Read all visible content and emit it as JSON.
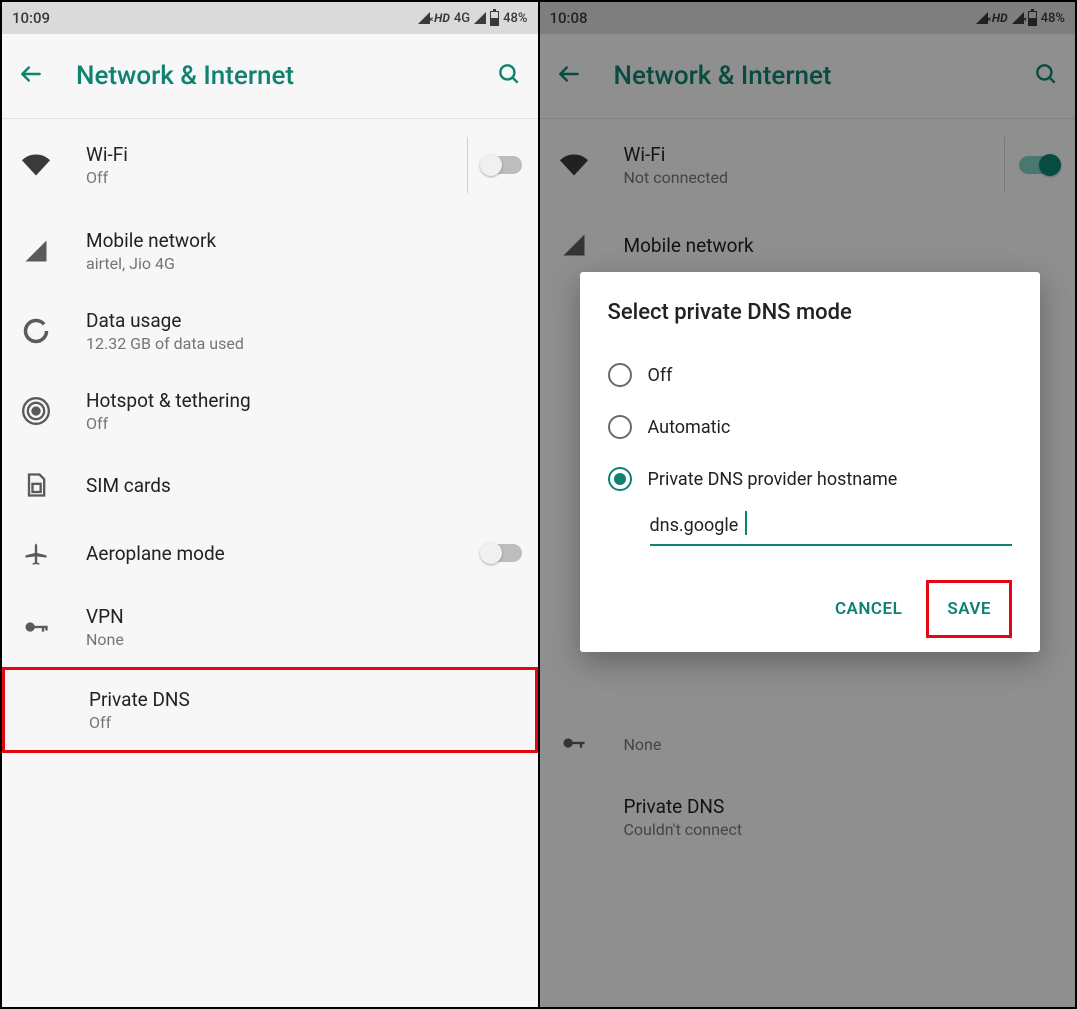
{
  "left": {
    "status": {
      "time": "10:09",
      "hd": "HD",
      "net": "4G",
      "battery": "48%"
    },
    "appbar": {
      "title": "Network & Internet"
    },
    "items": {
      "wifi": {
        "title": "Wi-Fi",
        "sub": "Off"
      },
      "mobile": {
        "title": "Mobile network",
        "sub": "airtel, Jio 4G"
      },
      "data": {
        "title": "Data usage",
        "sub": "12.32 GB of data used"
      },
      "hotspot": {
        "title": "Hotspot & tethering",
        "sub": "Off"
      },
      "sim": {
        "title": "SIM cards"
      },
      "aero": {
        "title": "Aeroplane mode"
      },
      "vpn": {
        "title": "VPN",
        "sub": "None"
      },
      "pdns": {
        "title": "Private DNS",
        "sub": "Off"
      }
    }
  },
  "right": {
    "status": {
      "time": "10:08",
      "hd": "HD",
      "battery": "48%"
    },
    "appbar": {
      "title": "Network & Internet"
    },
    "items": {
      "wifi": {
        "title": "Wi-Fi",
        "sub": "Not connected"
      },
      "mobile": {
        "title": "Mobile network"
      },
      "vpn": {
        "sub": "None"
      },
      "pdns": {
        "title": "Private DNS",
        "sub": "Couldn't connect"
      }
    },
    "dialog": {
      "title": "Select private DNS mode",
      "opt_off": "Off",
      "opt_auto": "Automatic",
      "opt_host": "Private DNS provider hostname",
      "hostname_value": "dns.google",
      "cancel": "CANCEL",
      "save": "SAVE"
    }
  }
}
